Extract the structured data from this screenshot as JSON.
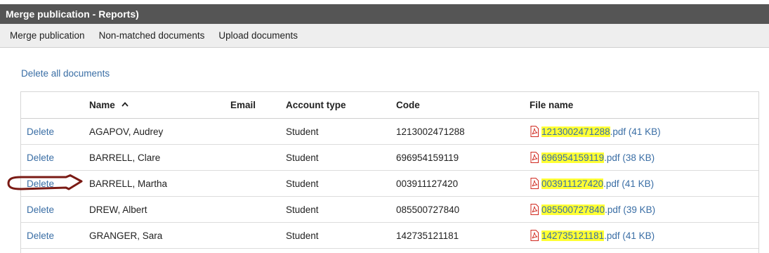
{
  "window": {
    "title": "Merge publication - Reports)"
  },
  "menu": {
    "items": [
      {
        "label": "Merge publication"
      },
      {
        "label": "Non-matched documents"
      },
      {
        "label": "Upload documents"
      }
    ]
  },
  "actions": {
    "delete_all": "Delete all documents"
  },
  "table": {
    "columns": {
      "delete": "",
      "name": "Name",
      "email": "Email",
      "account_type": "Account type",
      "code": "Code",
      "file_name": "File name"
    },
    "sort": {
      "column": "Name",
      "direction": "ascending",
      "icon": "caret-up-icon"
    },
    "rows": [
      {
        "delete": "Delete",
        "name": "AGAPOV, Audrey",
        "email": "",
        "account_type": "Student",
        "code": "1213002471288",
        "file_code": "1213002471288",
        "file_rest": ".pdf (41 KB)"
      },
      {
        "delete": "Delete",
        "name": "BARRELL, Clare",
        "email": "",
        "account_type": "Student",
        "code": "696954159119",
        "file_code": "696954159119",
        "file_rest": ".pdf (38 KB)"
      },
      {
        "delete": "Delete",
        "name": "BARRELL, Martha",
        "email": "",
        "account_type": "Student",
        "code": "003911127420",
        "file_code": "003911127420",
        "file_rest": ".pdf (41 KB)"
      },
      {
        "delete": "Delete",
        "name": "DREW, Albert",
        "email": "",
        "account_type": "Student",
        "code": "085500727840",
        "file_code": "085500727840",
        "file_rest": ".pdf (39 KB)"
      },
      {
        "delete": "Delete",
        "name": "GRANGER, Sara",
        "email": "",
        "account_type": "Student",
        "code": "142735121181",
        "file_code": "142735121181",
        "file_rest": ".pdf (41 KB)"
      }
    ]
  },
  "colors": {
    "title_bar_bg": "#555555",
    "link": "#3a6ea5",
    "highlight": "#ffff33",
    "annotation_arrow": "#7a1a14",
    "pdf_icon": "#d0281e"
  },
  "annotation": {
    "target": "row 3 delete link",
    "shape": "arrow-outline"
  }
}
